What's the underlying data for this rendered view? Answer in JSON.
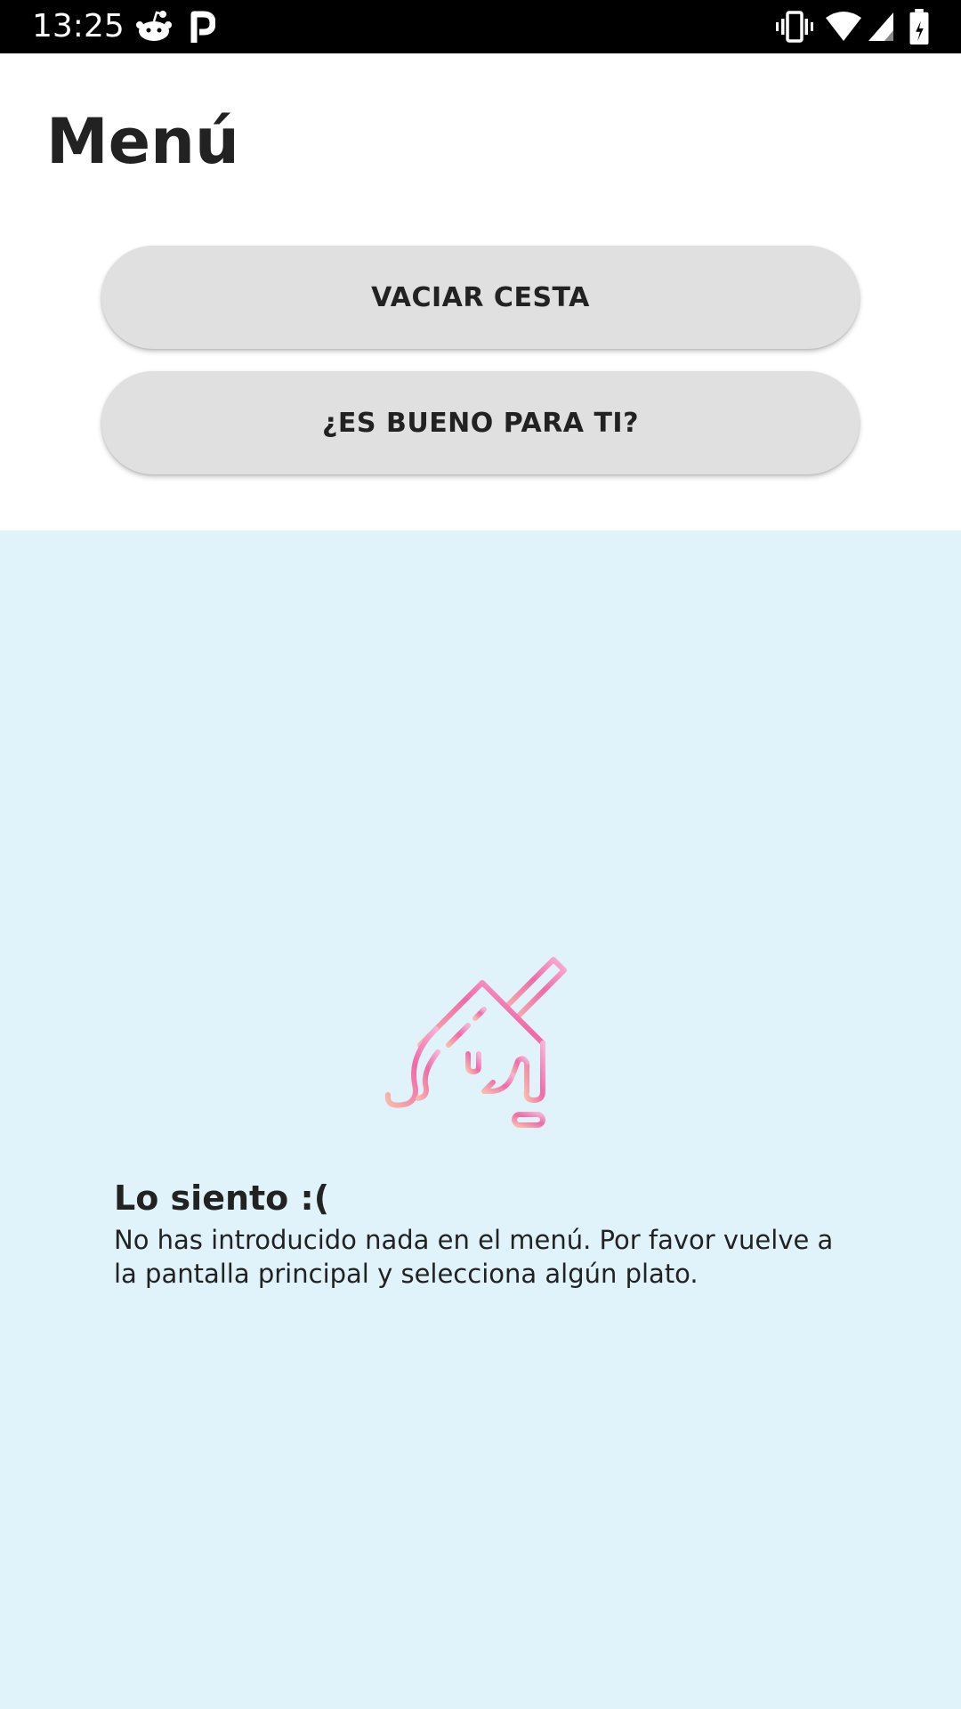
{
  "status_bar": {
    "time": "13:25",
    "left_icons": [
      "reddit-icon",
      "p-app-icon"
    ],
    "right_icons": [
      "vibrate-icon",
      "wifi-icon",
      "signal-icon",
      "battery-icon"
    ]
  },
  "header": {
    "title": "Menú"
  },
  "actions": {
    "empty_basket_label": "VACIAR CESTA",
    "good_for_you_label": "¿ES BUENO PARA TI?"
  },
  "empty_state": {
    "icon": "melting-house-icon",
    "title": "Lo siento :(",
    "message": "No has introducido nada en el menú. Por favor vuelve a la pantalla principal y selecciona algún plato."
  },
  "colors": {
    "status_bar_bg": "#000000",
    "button_bg": "#e0e0e0",
    "empty_area_bg": "#e0f3fb",
    "illustration_gradient_start": "#f9b3a8",
    "illustration_gradient_end": "#f06aa8",
    "text": "#222222"
  }
}
